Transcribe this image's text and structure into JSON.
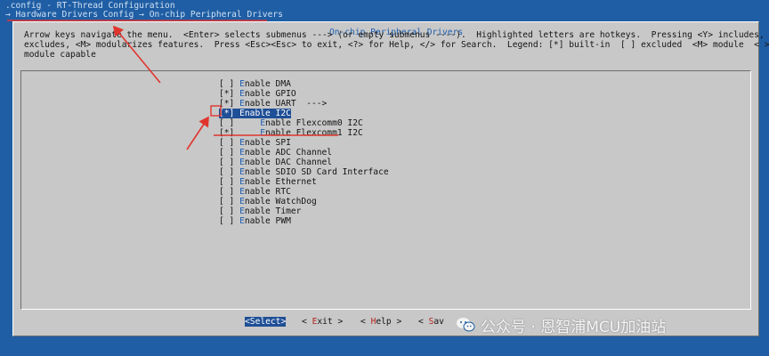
{
  "window": {
    "path_line": ".config - RT-Thread Configuration",
    "breadcrumb": "→ Hardware Drivers Config → On-chip Peripheral Drivers"
  },
  "dialog": {
    "title": "On-chip Peripheral Drivers",
    "help_lines": [
      "Arrow keys navigate the menu.  <Enter> selects submenus ---> (or empty submenus ----).  Highlighted letters are hotkeys.  Pressing <Y> includes, <N>",
      "excludes, <M> modularizes features.  Press <Esc><Esc> to exit, <?> for Help, </> for Search.  Legend: [*] built-in  [ ] excluded  <M> module  < >",
      "module capable"
    ]
  },
  "menu": {
    "items": [
      {
        "mark": "[ ] ",
        "indent": "",
        "hot": "E",
        "rest": "nable DMA",
        "selected": false
      },
      {
        "mark": "[*] ",
        "indent": "",
        "hot": "E",
        "rest": "nable GPIO",
        "selected": false
      },
      {
        "mark": "[*] ",
        "indent": "",
        "hot": "E",
        "rest": "nable UART  --->",
        "selected": false
      },
      {
        "mark": "[*] ",
        "indent": "",
        "hot": "E",
        "rest": "nable I2C",
        "selected": true
      },
      {
        "mark": "[ ] ",
        "indent": "    ",
        "hot": "E",
        "rest": "nable Flexcomm0 I2C",
        "selected": false
      },
      {
        "mark": "[*] ",
        "indent": "    ",
        "hot": "E",
        "rest": "nable Flexcomm1 I2C",
        "selected": false
      },
      {
        "mark": "[ ] ",
        "indent": "",
        "hot": "E",
        "rest": "nable SPI",
        "selected": false
      },
      {
        "mark": "[ ] ",
        "indent": "",
        "hot": "E",
        "rest": "nable ADC Channel",
        "selected": false
      },
      {
        "mark": "[ ] ",
        "indent": "",
        "hot": "E",
        "rest": "nable DAC Channel",
        "selected": false
      },
      {
        "mark": "[ ] ",
        "indent": "",
        "hot": "E",
        "rest": "nable SDIO SD Card Interface",
        "selected": false
      },
      {
        "mark": "[ ] ",
        "indent": "",
        "hot": "E",
        "rest": "nable Ethernet",
        "selected": false
      },
      {
        "mark": "[ ] ",
        "indent": "",
        "hot": "E",
        "rest": "nable RTC",
        "selected": false
      },
      {
        "mark": "[ ] ",
        "indent": "",
        "hot": "E",
        "rest": "nable WatchDog",
        "selected": false
      },
      {
        "mark": "[ ] ",
        "indent": "",
        "hot": "E",
        "rest": "nable Timer",
        "selected": false
      },
      {
        "mark": "[ ] ",
        "indent": "",
        "hot": "E",
        "rest": "nable PWM",
        "selected": false
      }
    ]
  },
  "buttons": [
    {
      "hot": "S",
      "rest": "elect",
      "active": true
    },
    {
      "hot": "E",
      "rest": "xit",
      "active": false
    },
    {
      "hot": "H",
      "rest": "elp",
      "active": false
    },
    {
      "hot": "S",
      "rest": "av",
      "active": false
    }
  ],
  "watermark": {
    "text": "公众号 · 恩智浦MCU加油站",
    "logo_icon": "wechat-logo-icon"
  },
  "colors": {
    "background_blue": "#1f5ea4",
    "dialog_gray": "#c8c8c8",
    "title_blue": "#1f5fb0",
    "selection_blue": "#1f4f96",
    "hotkey_red": "#b0241d",
    "annotation_red": "#e0352e"
  }
}
